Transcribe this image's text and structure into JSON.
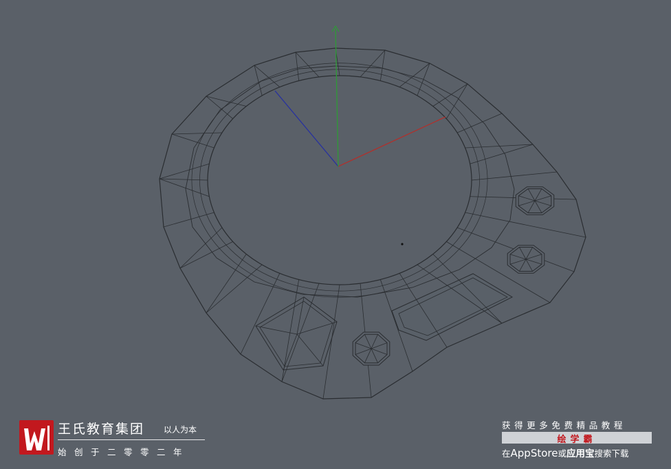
{
  "scene": {
    "background_color": "#5a6068",
    "mesh_color": "#2a2d31",
    "axes": {
      "x_color": "#b0302c",
      "y_color": "#2e9a36",
      "z_color": "#2630a0"
    }
  },
  "watermark_left": {
    "logo_glyph": "W",
    "company_name": "王氏教育集团",
    "slogan": "以人为本",
    "founded": "始创于二零零二年"
  },
  "watermark_right": {
    "line1": "获得更多免费精品教程",
    "product": "绘学霸",
    "line3_prefix": "在",
    "line3_store": "AppStore",
    "line3_or": "或",
    "line3_app": "应用宝",
    "line3_suffix": "搜索下载"
  }
}
